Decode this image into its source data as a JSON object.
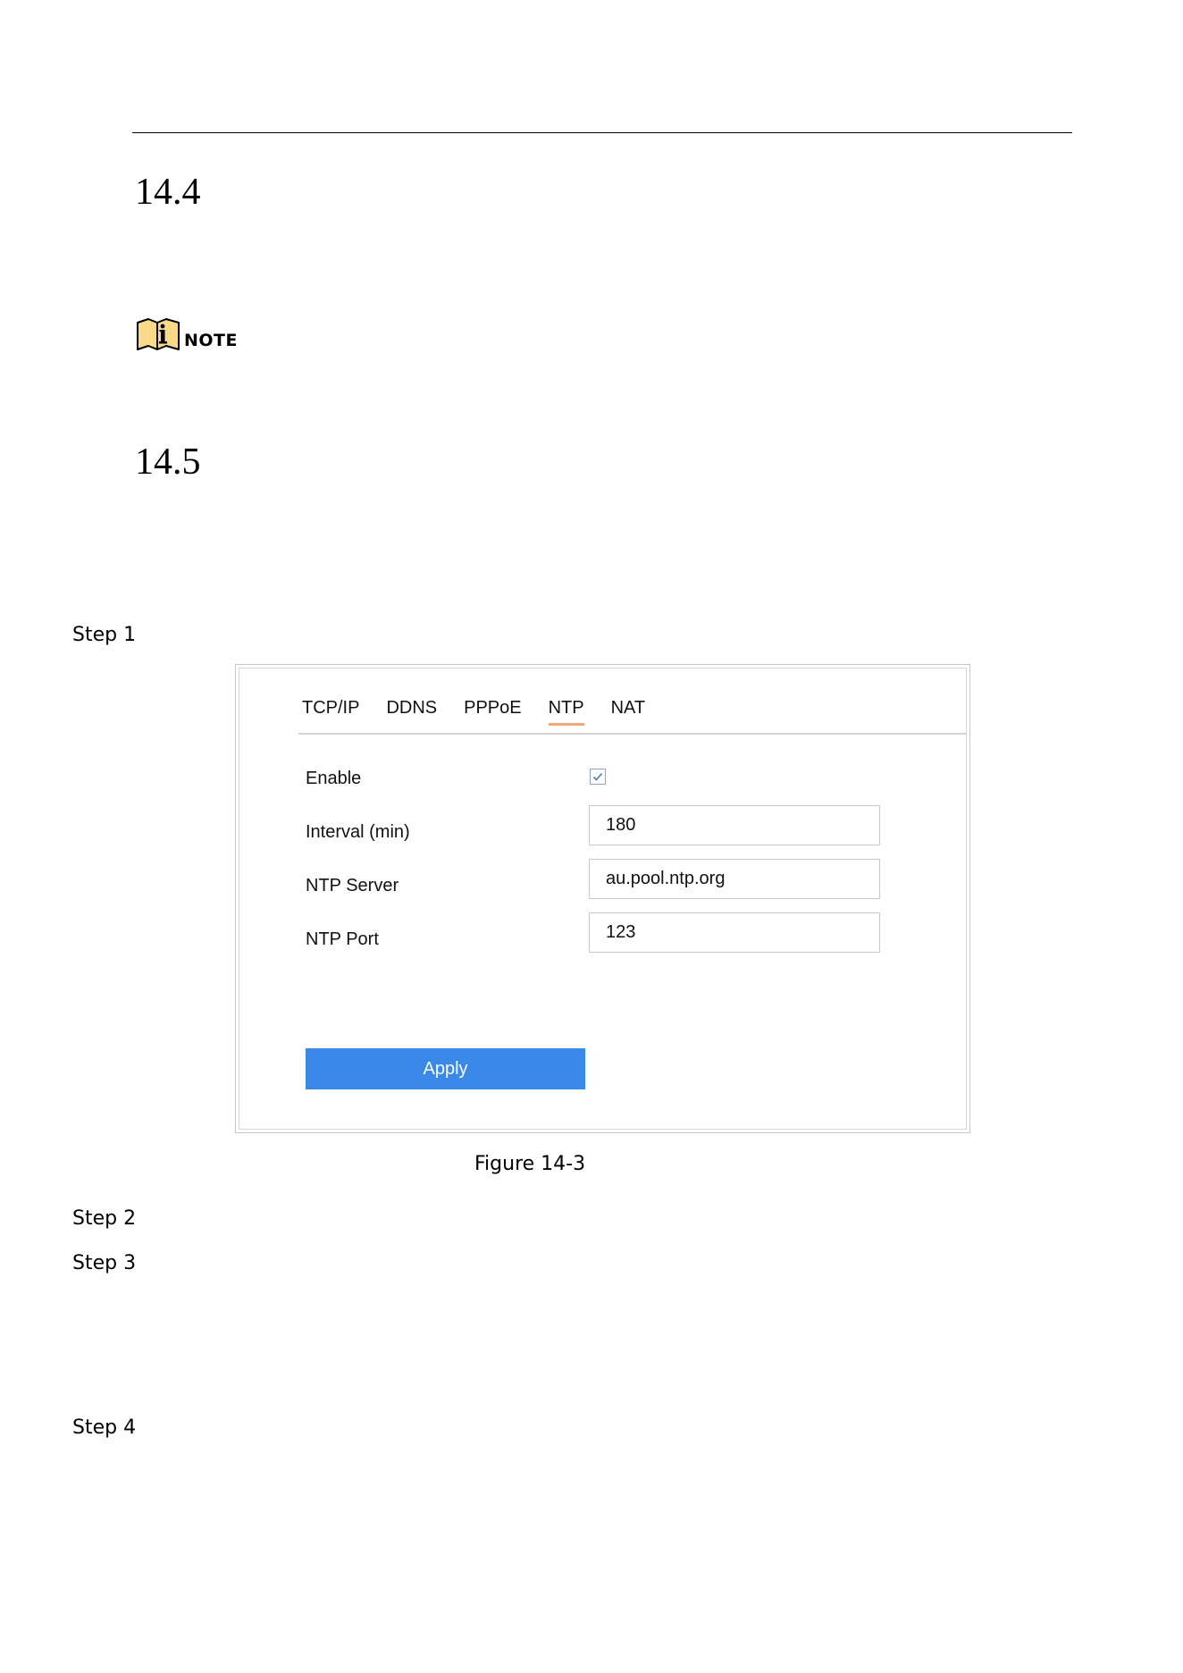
{
  "sections": [
    {
      "number": "14.4"
    },
    {
      "number": "14.5"
    }
  ],
  "note": {
    "label": "NOTE",
    "icon": "info-book-icon"
  },
  "steps": [
    "Step 1",
    "Step 2",
    "Step 3",
    "Step 4"
  ],
  "figure": {
    "caption": "Figure 14-3",
    "tabs": [
      {
        "label": "TCP/IP",
        "active": false
      },
      {
        "label": "DDNS",
        "active": false
      },
      {
        "label": "PPPoE",
        "active": false
      },
      {
        "label": "NTP",
        "active": true
      },
      {
        "label": "NAT",
        "active": false
      }
    ],
    "fields": {
      "enable": {
        "label": "Enable",
        "checked": true
      },
      "interval": {
        "label": "Interval (min)",
        "value": "180"
      },
      "server": {
        "label": "NTP Server",
        "value": "au.pool.ntp.org"
      },
      "port": {
        "label": "NTP Port",
        "value": "123"
      }
    },
    "apply_label": "Apply",
    "colors": {
      "apply_button": "#3a88e8",
      "active_tab_underline": "#f0a77a",
      "note_icon": "#fbd98a"
    }
  }
}
